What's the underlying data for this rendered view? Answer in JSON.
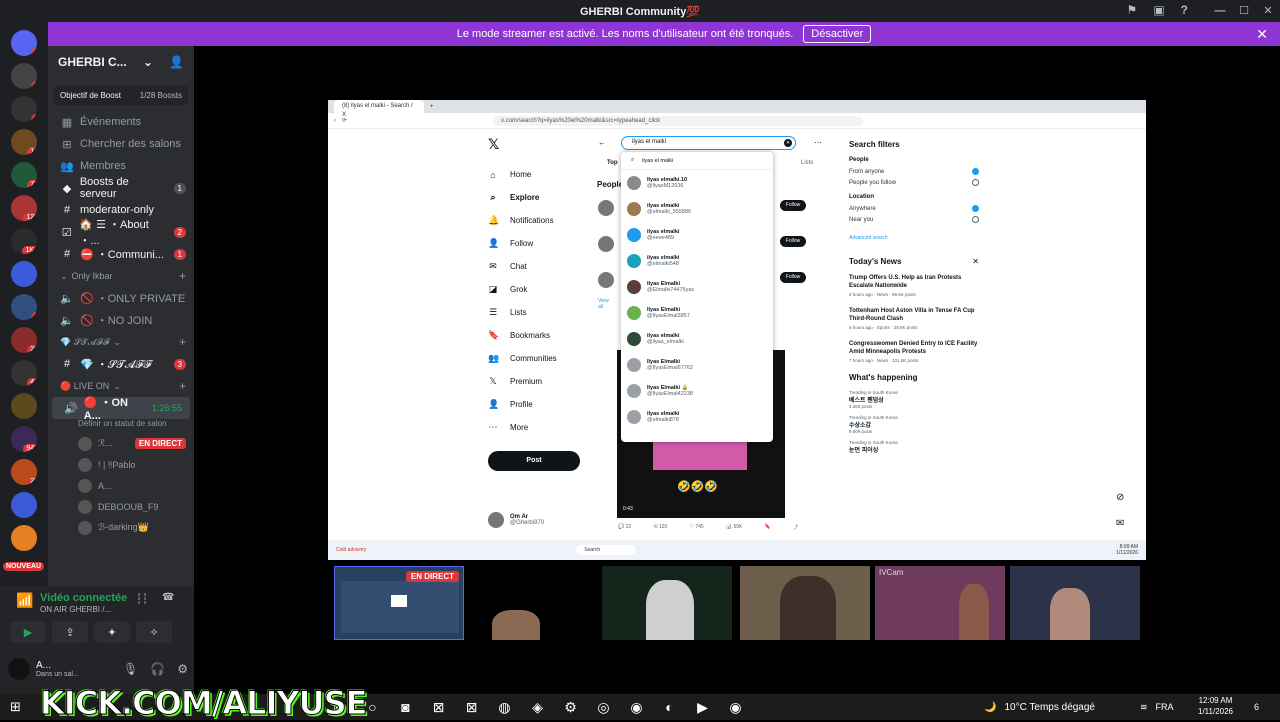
{
  "titlebar": {
    "title": "GHERBI Community💯",
    "min": "—",
    "max": "☐",
    "close": "✕"
  },
  "banner": {
    "text": "Le mode streamer est activé. Les noms d'utilisateur ont été tronqués.",
    "button": "Désactiver"
  },
  "rail": {
    "servers": [
      {
        "label": "",
        "badge": "7"
      },
      {
        "label": "",
        "badge": "1"
      },
      {
        "label": "",
        "badge": "1"
      },
      {
        "label": "",
        "badge": "14"
      },
      {
        "label": "",
        "badge": "78"
      },
      {
        "label": "",
        "badge": "123"
      },
      {
        "label": "",
        "badge": "1K+"
      },
      {
        "label": "",
        "badge": ""
      },
      {
        "label": "",
        "badge": "3"
      },
      {
        "label": "",
        "badge": "26"
      },
      {
        "label": "",
        "badge": "47"
      },
      {
        "label": "",
        "badge": ""
      },
      {
        "label": "",
        "badge": "945"
      },
      {
        "label": "",
        "badge": "25"
      },
      {
        "label": "",
        "badge": ""
      },
      {
        "label": "",
        "badge": ""
      }
    ],
    "new_label": "NOUVEAU"
  },
  "server": {
    "name": "GHERBI C...",
    "boost_label": "Objectif de Boost",
    "boost_count": "1/28 Boosts",
    "items": [
      {
        "icon": "▦",
        "label": "Événements",
        "count": ""
      },
      {
        "icon": "⊞",
        "label": "Chercher des salons",
        "count": ""
      },
      {
        "icon": "👥",
        "label": "Membres",
        "count": ""
      },
      {
        "icon": "◆",
        "label": "Boosts de serveur",
        "count": "1"
      }
    ],
    "channels": [
      {
        "icon": "#",
        "label": "moderator-only",
        "count": ""
      },
      {
        "icon": "☑",
        "label": "🏠 ☰ ・About ・...",
        "count": "2"
      },
      {
        "icon": "#",
        "label": "⛔ ・Communi...",
        "count": "1"
      }
    ],
    "cat1": "Only Ikbar",
    "voice1": [
      "🚫 ・ONLY PRIVATE",
      "🚫 ・NO JOIN"
    ],
    "cat2": "💎 𝓢𝓣𝓐𝓕𝓕",
    "staff_channel": "💎 ・𝓢𝓣𝓐𝓕𝓕",
    "staff_count": "3",
    "cat3": "🔴 LIVE ON",
    "live_channel": "🔴 ・ON A...",
    "live_timer": "1:26:55",
    "live_status": "Définir un statut de salon",
    "live_users": [
      {
        "name": "ℛ...",
        "tag": "EN DIRECT"
      },
      {
        "name": "! | ‼Pablo",
        "tag": ""
      },
      {
        "name": "A...",
        "tag": ""
      },
      {
        "name": "DEBOOUB_F9",
        "tag": ""
      },
      {
        "name": "ℬ-darking👑",
        "tag": ""
      }
    ]
  },
  "voice": {
    "connected": "Vidéo connectée",
    "sub": "ON AIR GHERBI /...",
    "user": "A...",
    "user_status": "Dans un sal..."
  },
  "browser": {
    "tab": "(8) ilyas el malki - Search / X",
    "url": "x.com/search?q=ilyas%20el%20malki&src=typeahead_click",
    "nav": [
      {
        "icon": "⌂",
        "label": "Home",
        "bold": false
      },
      {
        "icon": "⌕",
        "label": "Explore",
        "bold": true
      },
      {
        "icon": "🔔",
        "label": "Notifications",
        "bold": false
      },
      {
        "icon": "👤",
        "label": "Follow",
        "bold": false
      },
      {
        "icon": "✉",
        "label": "Chat",
        "bold": false
      },
      {
        "icon": "◪",
        "label": "Grok",
        "bold": false
      },
      {
        "icon": "☰",
        "label": "Lists",
        "bold": false
      },
      {
        "icon": "🔖",
        "label": "Bookmarks",
        "bold": false
      },
      {
        "icon": "👥",
        "label": "Communities",
        "bold": false
      },
      {
        "icon": "𝕏",
        "label": "Premium",
        "bold": false
      },
      {
        "icon": "👤",
        "label": "Profile",
        "bold": false
      },
      {
        "icon": "⋯",
        "label": "More",
        "bold": false
      }
    ],
    "post": "Post",
    "me_name": "Om Ar",
    "me_handle": "@Gherbi970",
    "search_value": "ilyas el malki",
    "dropdown_query": "ilyas el malki",
    "results": [
      {
        "name": "Ilyas elmalki.10",
        "handle": "@ilyasM12936",
        "color": "#8a8a8a"
      },
      {
        "name": "ilyas elmalki",
        "handle": "@elmalki_555886",
        "color": "#9a7b4f"
      },
      {
        "name": "ilyas elmalki",
        "handle": "@eeee489",
        "color": "#1d9bf0"
      },
      {
        "name": "ilyas elmalki",
        "handle": "@elmalki548",
        "color": "#17a2b8"
      },
      {
        "name": "Ilyas Elmalki",
        "handle": "@Elmalki74475yas",
        "color": "#5a3d3d"
      },
      {
        "name": "Ilyas Elmalki",
        "handle": "@IlyasElmal3857",
        "color": "#6ab04c"
      },
      {
        "name": "ilyas elmalki",
        "handle": "@ilyas_elmalki",
        "color": "#2d4a3a"
      },
      {
        "name": "Ilyas Elmalki",
        "handle": "@IlyasElmal67762",
        "color": "#9aa0a6"
      },
      {
        "name": "Ilyas Elmalki 🔒",
        "handle": "@IlyasElmal42238",
        "color": "#9aa0a6"
      },
      {
        "name": "ilyas elmalki",
        "handle": "@elmalki878",
        "color": "#9aa0a6"
      }
    ],
    "tabs_top": "Top",
    "tabs_lists": "Lists",
    "people_heading": "People",
    "follow": "Follow",
    "view_all": "View all",
    "video_time": "0:43",
    "actions": [
      "💬 22",
      "⟲ 120",
      "♡ 745",
      "📊 55K",
      "🔖",
      "⤴"
    ],
    "filters": {
      "title": "Search filters",
      "people": "People",
      "from_anyone": "From anyone",
      "you_follow": "People you follow",
      "location": "Location",
      "anywhere": "Anywhere",
      "near_you": "Near you",
      "advanced": "Advanced search"
    },
    "news_title": "Today's News",
    "news": [
      {
        "title": "Trump Offers U.S. Help as Iran Protests Escalate Nationwide",
        "meta": "2 hours ago · News · 66.6K posts"
      },
      {
        "title": "Tottenham Host Aston Villa in Tense FA Cup Third-Round Clash",
        "meta": "6 hours ago · Sports · 29.8K posts"
      },
      {
        "title": "Congresswomen Denied Entry to ICE Facility Amid Minneapolis Protests",
        "meta": "7 hours ago · News · 131.6K posts"
      }
    ],
    "happening": "What's happening",
    "trends": [
      {
        "loc": "Trending in South Korea",
        "name": "베스트 팬덤상",
        "posts": "3,383 posts"
      },
      {
        "loc": "Trending in South Korea",
        "name": "수상소감",
        "posts": "9,909 posts"
      },
      {
        "loc": "Trending in South Korea",
        "name": "눈먼 피어싱",
        "posts": ""
      }
    ],
    "win_search": "Search",
    "win_time": "8:09 AM",
    "win_date": "1/11/2026",
    "weather_small": "Cold advisory"
  },
  "cams": {
    "live": "EN DIRECT",
    "ivcam": "IVCam"
  },
  "kick": "KICK.COM/ALIYUSE",
  "taskbar": {
    "weather": "10°C  Temps dégagé",
    "lang": "FRA",
    "time": "12:09 AM",
    "date": "1/11/2026",
    "notif": "6"
  }
}
